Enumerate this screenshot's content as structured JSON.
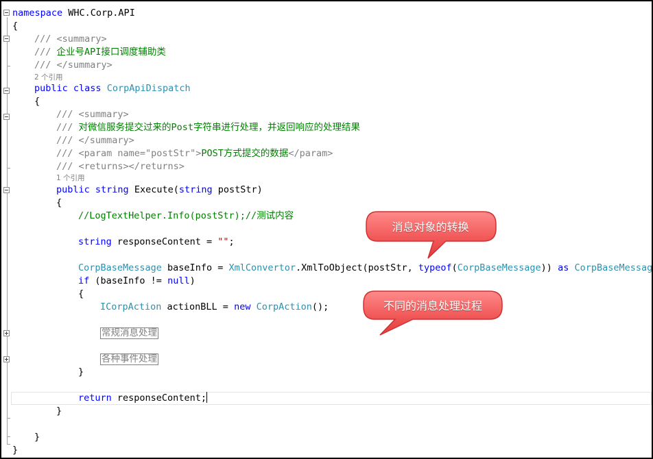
{
  "editor": {
    "lines": {
      "ns_kw": "namespace",
      "ns_name": " WHC.Corp.API",
      "open_brace": "{",
      "close_brace": "}",
      "doc_open": "/// <summary>",
      "class_summary_prefix": "/// ",
      "class_summary": "企业号API接口调度辅助类",
      "doc_close": "/// </summary>",
      "class_refs": "2 个引用",
      "public_kw": "public",
      "class_kw": "class",
      "class_name": "CorpApiDispatch",
      "method_summary_prefix": "/// ",
      "method_summary": "对微信服务提交过来的Post字符串进行处理，并返回响应的处理结果",
      "param_open": "/// <param name=\"postStr\">",
      "param_text": "POST方式提交的数据",
      "param_close": "</param>",
      "returns": "/// <returns></returns>",
      "method_refs": "1 个引用",
      "string_kw": "string",
      "method_name": " Execute(",
      "param_name": " postStr)",
      "log_comment": "//LogTextHelper.Info(postStr);//测试内容",
      "response_decl": " responseContent = ",
      "empty_string": "\"\"",
      "semicolon": ";",
      "base_type": "CorpBaseMessage",
      "base_var": " baseInfo = ",
      "convertor": "XmlConvertor",
      "xml_call": ".XmlToObject(postStr, ",
      "typeof_kw": "typeof",
      "paren_open": "(",
      "paren_close_space": ")) ",
      "as_kw": "as",
      "if_kw": "if",
      "if_cond": " (baseInfo != ",
      "null_kw": "null",
      "paren_close": ")",
      "iface_type": "ICorpAction",
      "action_var": " actionBLL = ",
      "new_kw": "new",
      "action_type": "CorpAction",
      "call_end": "();",
      "region_1": "常规消息处理",
      "region_2": "各种事件处理",
      "return_kw": "return",
      "return_value": " responseContent;"
    }
  },
  "callouts": [
    {
      "text": "消息对象的转换"
    },
    {
      "text": "不同的消息处理过程"
    }
  ],
  "colors": {
    "keyword": "#0000ff",
    "type": "#2b91af",
    "comment": "#008000",
    "xml_doc": "#808080",
    "string": "#a31515",
    "callout_fill": "#f25a5a",
    "callout_border": "#d03030"
  },
  "icons": {
    "fold_collapse": "minus-box-icon",
    "fold_expand": "plus-box-icon"
  }
}
